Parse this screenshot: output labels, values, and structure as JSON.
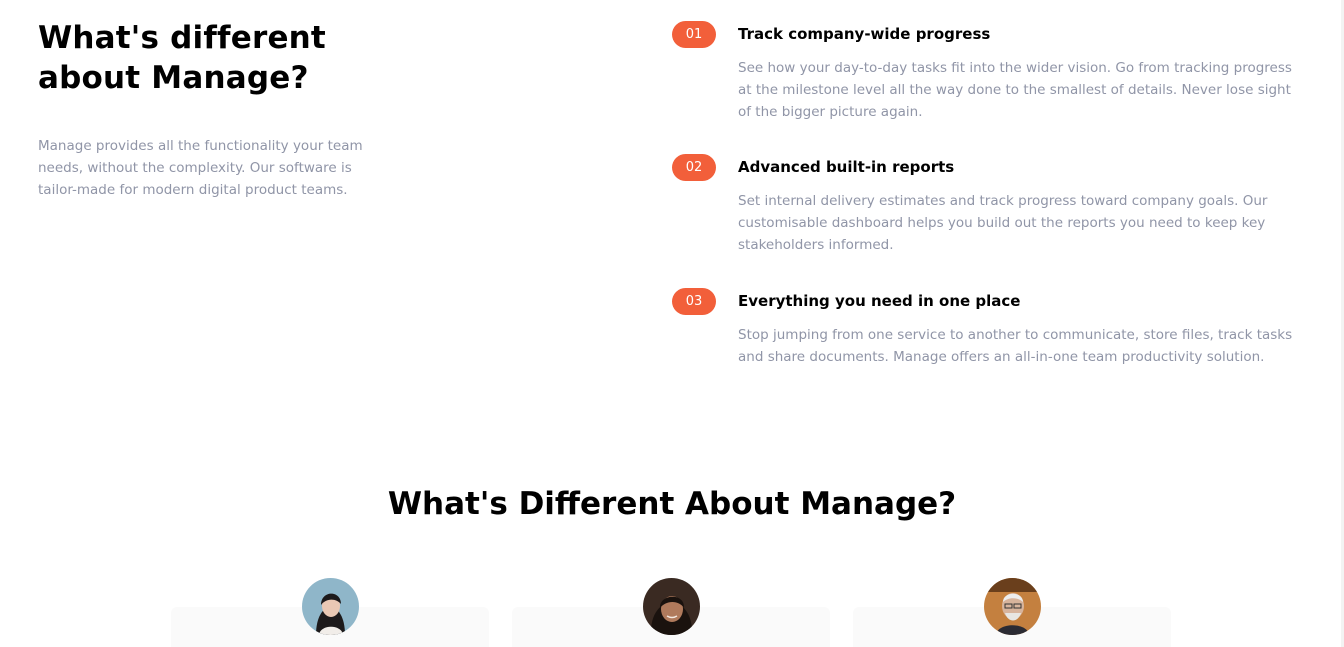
{
  "intro": {
    "title": "What's different about Manage?",
    "text": "Manage provides all the functionality your team needs, without the complexity. Our software is tailor-made for modern digital product teams."
  },
  "features": [
    {
      "number": "01",
      "title": "Track company-wide progress",
      "text": "See how your day-to-day tasks fit into the wider vision. Go from tracking progress at the milestone level all the way done to the smallest of details. Never lose sight of the bigger picture again."
    },
    {
      "number": "02",
      "title": "Advanced built-in reports",
      "text": "Set internal delivery estimates and track progress toward company goals. Our customisable dashboard helps you build out the reports you need to keep key stakeholders informed."
    },
    {
      "number": "03",
      "title": "Everything you need in one place",
      "text": "Stop jumping from one service to another to communicate, store files, track tasks and share documents. Manage offers an all-in-one team productivity solution."
    }
  ],
  "testimonials": {
    "title": "What's Different About Manage?"
  },
  "colors": {
    "accent": "#f25f3a",
    "muted_text": "#9095a7",
    "card_bg": "#fafafa"
  }
}
